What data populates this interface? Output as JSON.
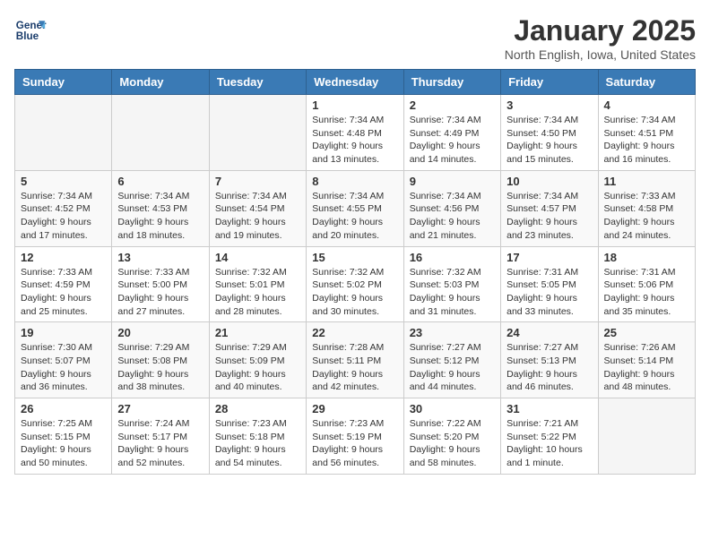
{
  "header": {
    "logo_line1": "General",
    "logo_line2": "Blue",
    "month_title": "January 2025",
    "location": "North English, Iowa, United States"
  },
  "weekdays": [
    "Sunday",
    "Monday",
    "Tuesday",
    "Wednesday",
    "Thursday",
    "Friday",
    "Saturday"
  ],
  "weeks": [
    [
      {
        "day": "",
        "empty": true
      },
      {
        "day": "",
        "empty": true
      },
      {
        "day": "",
        "empty": true
      },
      {
        "day": "1",
        "sunrise": "7:34 AM",
        "sunset": "4:48 PM",
        "daylight": "9 hours and 13 minutes."
      },
      {
        "day": "2",
        "sunrise": "7:34 AM",
        "sunset": "4:49 PM",
        "daylight": "9 hours and 14 minutes."
      },
      {
        "day": "3",
        "sunrise": "7:34 AM",
        "sunset": "4:50 PM",
        "daylight": "9 hours and 15 minutes."
      },
      {
        "day": "4",
        "sunrise": "7:34 AM",
        "sunset": "4:51 PM",
        "daylight": "9 hours and 16 minutes."
      }
    ],
    [
      {
        "day": "5",
        "sunrise": "7:34 AM",
        "sunset": "4:52 PM",
        "daylight": "9 hours and 17 minutes."
      },
      {
        "day": "6",
        "sunrise": "7:34 AM",
        "sunset": "4:53 PM",
        "daylight": "9 hours and 18 minutes."
      },
      {
        "day": "7",
        "sunrise": "7:34 AM",
        "sunset": "4:54 PM",
        "daylight": "9 hours and 19 minutes."
      },
      {
        "day": "8",
        "sunrise": "7:34 AM",
        "sunset": "4:55 PM",
        "daylight": "9 hours and 20 minutes."
      },
      {
        "day": "9",
        "sunrise": "7:34 AM",
        "sunset": "4:56 PM",
        "daylight": "9 hours and 21 minutes."
      },
      {
        "day": "10",
        "sunrise": "7:34 AM",
        "sunset": "4:57 PM",
        "daylight": "9 hours and 23 minutes."
      },
      {
        "day": "11",
        "sunrise": "7:33 AM",
        "sunset": "4:58 PM",
        "daylight": "9 hours and 24 minutes."
      }
    ],
    [
      {
        "day": "12",
        "sunrise": "7:33 AM",
        "sunset": "4:59 PM",
        "daylight": "9 hours and 25 minutes."
      },
      {
        "day": "13",
        "sunrise": "7:33 AM",
        "sunset": "5:00 PM",
        "daylight": "9 hours and 27 minutes."
      },
      {
        "day": "14",
        "sunrise": "7:32 AM",
        "sunset": "5:01 PM",
        "daylight": "9 hours and 28 minutes."
      },
      {
        "day": "15",
        "sunrise": "7:32 AM",
        "sunset": "5:02 PM",
        "daylight": "9 hours and 30 minutes."
      },
      {
        "day": "16",
        "sunrise": "7:32 AM",
        "sunset": "5:03 PM",
        "daylight": "9 hours and 31 minutes."
      },
      {
        "day": "17",
        "sunrise": "7:31 AM",
        "sunset": "5:05 PM",
        "daylight": "9 hours and 33 minutes."
      },
      {
        "day": "18",
        "sunrise": "7:31 AM",
        "sunset": "5:06 PM",
        "daylight": "9 hours and 35 minutes."
      }
    ],
    [
      {
        "day": "19",
        "sunrise": "7:30 AM",
        "sunset": "5:07 PM",
        "daylight": "9 hours and 36 minutes."
      },
      {
        "day": "20",
        "sunrise": "7:29 AM",
        "sunset": "5:08 PM",
        "daylight": "9 hours and 38 minutes."
      },
      {
        "day": "21",
        "sunrise": "7:29 AM",
        "sunset": "5:09 PM",
        "daylight": "9 hours and 40 minutes."
      },
      {
        "day": "22",
        "sunrise": "7:28 AM",
        "sunset": "5:11 PM",
        "daylight": "9 hours and 42 minutes."
      },
      {
        "day": "23",
        "sunrise": "7:27 AM",
        "sunset": "5:12 PM",
        "daylight": "9 hours and 44 minutes."
      },
      {
        "day": "24",
        "sunrise": "7:27 AM",
        "sunset": "5:13 PM",
        "daylight": "9 hours and 46 minutes."
      },
      {
        "day": "25",
        "sunrise": "7:26 AM",
        "sunset": "5:14 PM",
        "daylight": "9 hours and 48 minutes."
      }
    ],
    [
      {
        "day": "26",
        "sunrise": "7:25 AM",
        "sunset": "5:15 PM",
        "daylight": "9 hours and 50 minutes."
      },
      {
        "day": "27",
        "sunrise": "7:24 AM",
        "sunset": "5:17 PM",
        "daylight": "9 hours and 52 minutes."
      },
      {
        "day": "28",
        "sunrise": "7:23 AM",
        "sunset": "5:18 PM",
        "daylight": "9 hours and 54 minutes."
      },
      {
        "day": "29",
        "sunrise": "7:23 AM",
        "sunset": "5:19 PM",
        "daylight": "9 hours and 56 minutes."
      },
      {
        "day": "30",
        "sunrise": "7:22 AM",
        "sunset": "5:20 PM",
        "daylight": "9 hours and 58 minutes."
      },
      {
        "day": "31",
        "sunrise": "7:21 AM",
        "sunset": "5:22 PM",
        "daylight": "10 hours and 1 minute."
      },
      {
        "day": "",
        "empty": true
      }
    ]
  ],
  "labels": {
    "sunrise": "Sunrise:",
    "sunset": "Sunset:",
    "daylight": "Daylight hours"
  }
}
